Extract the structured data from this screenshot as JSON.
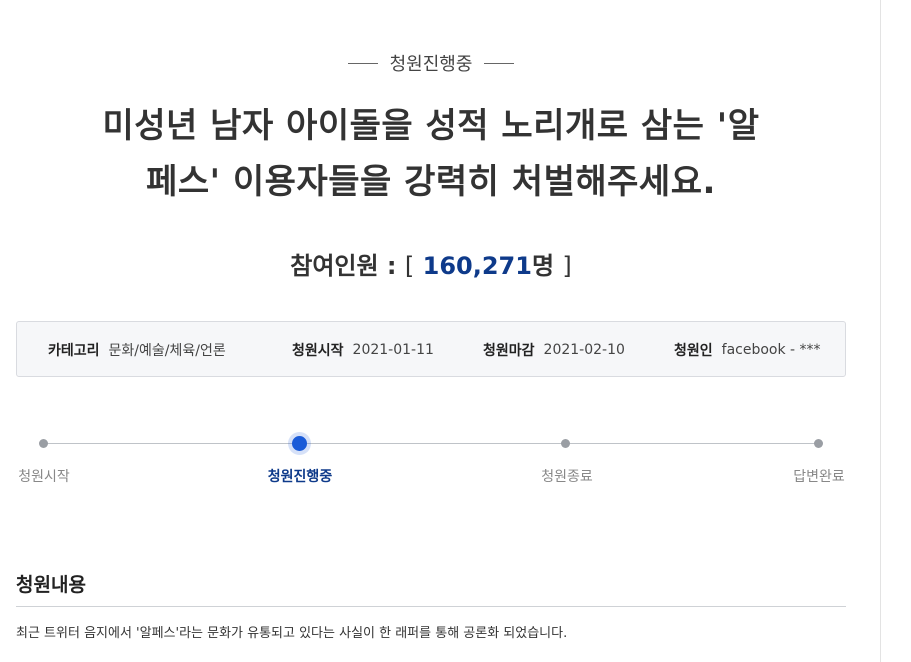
{
  "status": {
    "label": "청원진행중"
  },
  "petition": {
    "title_line1": "미성년 남자 아이돌을 성적 노리개로 삼는 '알",
    "title_line2": "페스' 이용자들을 강력히 처벌해주세요."
  },
  "participants": {
    "label": "참여인원",
    "separator": ":",
    "open_bracket": "[",
    "count": "160,271",
    "unit": "명",
    "close_bracket": "]"
  },
  "info": [
    {
      "key": "카테고리",
      "value": "문화/예술/체육/언론"
    },
    {
      "key": "청원시작",
      "value": "2021-01-11"
    },
    {
      "key": "청원마감",
      "value": "2021-02-10"
    },
    {
      "key": "청원인",
      "value": "facebook - ***"
    }
  ],
  "progress": {
    "steps": [
      {
        "label": "청원시작",
        "active": false
      },
      {
        "label": "청원진행중",
        "active": true
      },
      {
        "label": "청원종료",
        "active": false
      },
      {
        "label": "답변완료",
        "active": false
      }
    ]
  },
  "content": {
    "section_title": "청원내용",
    "first_line": "최근 트위터 음지에서 '알페스'라는 문화가 유통되고 있다는 사실이 한 래퍼를 통해 공론화 되었습니다."
  },
  "colors": {
    "accent": "#0e3a8a",
    "active_dot": "#1a5bd8",
    "info_bg": "#f6f7f9"
  }
}
